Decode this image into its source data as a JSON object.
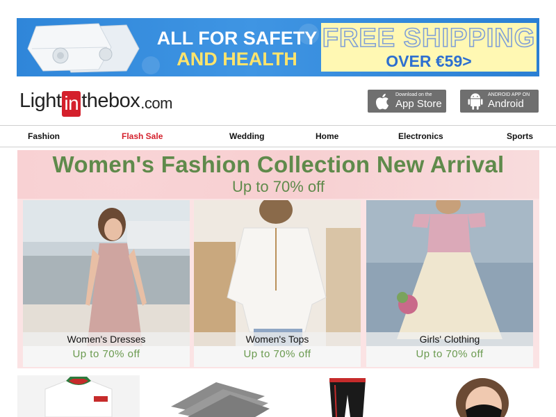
{
  "banner": {
    "line1": "ALL FOR SAFETY",
    "line2": "AND HEALTH",
    "shipping_title": "FREE SHIPPING",
    "shipping_sub": "OVER €59>",
    "colors": {
      "background": "#3a8fe0",
      "accent_yellow": "#ffe46b",
      "shipping_bg": "#fff8b3",
      "shipping_text": "#2d6fd0"
    }
  },
  "logo": {
    "part1": "Light",
    "part2": "in",
    "part3": "thebox",
    "part4": ".com",
    "accent": "#d4202c"
  },
  "apps": {
    "apple": {
      "sub": "Download on the",
      "main": "App Store",
      "icon": "apple-icon"
    },
    "android": {
      "sub": "ANDROID APP ON",
      "main": "Android",
      "icon": "android-icon"
    }
  },
  "nav": [
    {
      "label": "Fashion"
    },
    {
      "label": "Flash Sale",
      "highlight": true
    },
    {
      "label": "Wedding"
    },
    {
      "label": "Home"
    },
    {
      "label": "Electronics"
    },
    {
      "label": "Sports"
    }
  ],
  "promo": {
    "title": "Women's Fashion Collection New Arrival",
    "subtitle": "Up to 70% off",
    "accent": "#5f8a4b",
    "cards": [
      {
        "caption": "Women's Dresses",
        "offer": "Up to 70% off"
      },
      {
        "caption": "Women's Tops",
        "offer": "Up to 70% off"
      },
      {
        "caption": "Girls' Clothing",
        "offer": "Up to 70% off"
      }
    ]
  }
}
